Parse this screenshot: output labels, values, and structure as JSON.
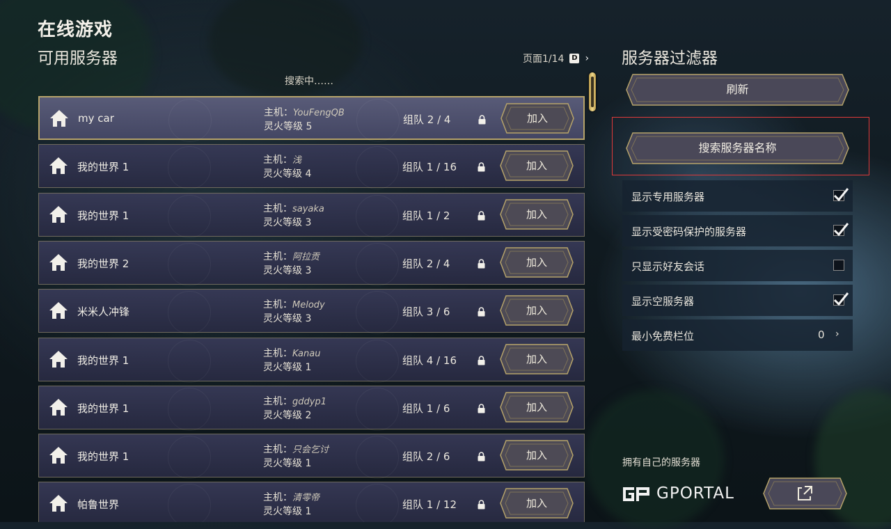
{
  "header": {
    "page_title": "在线游戏",
    "section_title": "可用服务器",
    "pager_text": "页面1/14",
    "pager_key": "D",
    "pager_next": "›",
    "searching_text": "搜索中……"
  },
  "servers": [
    {
      "name": "my car",
      "host_label": "主机：",
      "host": "YouFengQB",
      "level": "灵火等级 5",
      "party": "组队 2 / 4",
      "join": "加入"
    },
    {
      "name": "我的世界 1",
      "host_label": "主机：",
      "host": "浅",
      "level": "灵火等级 4",
      "party": "组队 1 / 16",
      "join": "加入"
    },
    {
      "name": "我的世界 1",
      "host_label": "主机：",
      "host": "sayaka",
      "level": "灵火等级 3",
      "party": "组队 1 / 2",
      "join": "加入"
    },
    {
      "name": "我的世界 2",
      "host_label": "主机：",
      "host": "阿拉贡",
      "level": "灵火等级 3",
      "party": "组队 2 / 4",
      "join": "加入"
    },
    {
      "name": "米米人冲锋",
      "host_label": "主机：",
      "host": "Melody",
      "level": "灵火等级 3",
      "party": "组队 3 / 6",
      "join": "加入"
    },
    {
      "name": "我的世界 1",
      "host_label": "主机：",
      "host": "Kanau",
      "level": "灵火等级 1",
      "party": "组队 4 / 16",
      "join": "加入"
    },
    {
      "name": "我的世界 1",
      "host_label": "主机：",
      "host": "gddyp1",
      "level": "灵火等级 2",
      "party": "组队 1 / 6",
      "join": "加入"
    },
    {
      "name": "我的世界 1",
      "host_label": "主机：",
      "host": "只会乞讨",
      "level": "灵火等级 1",
      "party": "组队 2 / 6",
      "join": "加入"
    },
    {
      "name": "帕鲁世界",
      "host_label": "主机：",
      "host": "清零帝",
      "level": "灵火等级 1",
      "party": "组队 1 / 12",
      "join": "加入"
    }
  ],
  "filters": {
    "title": "服务器过滤器",
    "refresh_label": "刷新",
    "search_name_label": "搜索服务器名称",
    "options": [
      {
        "label": "显示专用服务器",
        "checked": true
      },
      {
        "label": "显示受密码保护的服务器",
        "checked": true
      },
      {
        "label": "只显示好友会话",
        "checked": false
      },
      {
        "label": "显示空服务器",
        "checked": true
      }
    ],
    "min_slots_label": "最小免费栏位",
    "min_slots_value": "0",
    "min_slots_arrow": "›"
  },
  "footer": {
    "own_server_label": "拥有自己的服务器",
    "brand": "GPORTAL"
  },
  "colors": {
    "accent_gold": "#b6a36a",
    "row_bg": "#383a58",
    "highlight_red": "#e03a3a"
  }
}
